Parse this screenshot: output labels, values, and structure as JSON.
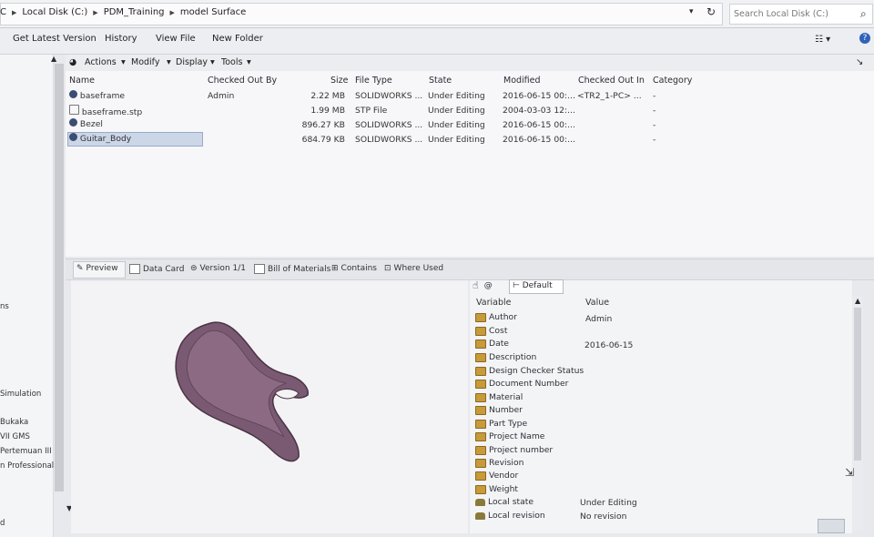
{
  "breadcrumb": {
    "items": [
      "C",
      "Local Disk (C:)",
      "PDM_Training",
      "model Surface"
    ]
  },
  "search": {
    "placeholder": "Search Local Disk (C:)"
  },
  "command_bar": {
    "items": [
      "Get Latest Version",
      "History",
      "View File",
      "New Folder"
    ]
  },
  "toolbar": {
    "items": [
      "Actions",
      "Modify",
      "Display",
      "Tools"
    ]
  },
  "columns": [
    "Name",
    "Checked Out By",
    "Size",
    "File Type",
    "State",
    "Modified",
    "Checked Out In",
    "Category"
  ],
  "files": [
    {
      "name": "baseframe",
      "checked_out_by": "Admin",
      "size": "2.22 MB",
      "type": "SOLIDWORKS ...",
      "state": "Under Editing",
      "modified": "2016-06-15 00:...",
      "checked_out_in": "<TR2_1-PC> ...",
      "category": "-"
    },
    {
      "name": "baseframe.stp",
      "checked_out_by": "",
      "size": "1.99 MB",
      "type": "STP File",
      "state": "Under Editing",
      "modified": "2004-03-03 12:...",
      "checked_out_in": "",
      "category": "-"
    },
    {
      "name": "Bezel",
      "checked_out_by": "",
      "size": "896.27 KB",
      "type": "SOLIDWORKS ...",
      "state": "Under Editing",
      "modified": "2016-06-15 00:...",
      "checked_out_in": "",
      "category": "-"
    },
    {
      "name": "Guitar_Body",
      "checked_out_by": "",
      "size": "684.79 KB",
      "type": "SOLIDWORKS ...",
      "state": "Under Editing",
      "modified": "2016-06-15 00:...",
      "checked_out_in": "",
      "category": "-"
    }
  ],
  "tabs": [
    "Preview",
    "Data Card",
    "Version 1/1",
    "Bill of Materials",
    "Contains",
    "Where Used"
  ],
  "nav": {
    "items": [
      "ns",
      "Simulation",
      "Bukaka",
      "VII GMS",
      "Pertemuan III",
      "n Professional II",
      "d"
    ]
  },
  "card": {
    "config": "Default",
    "header_variable": "Variable",
    "header_value": "Value",
    "variables": [
      {
        "name": "Author",
        "value": "Admin"
      },
      {
        "name": "Cost",
        "value": ""
      },
      {
        "name": "Date",
        "value": "2016-06-15"
      },
      {
        "name": "Description",
        "value": ""
      },
      {
        "name": "Design Checker Status",
        "value": ""
      },
      {
        "name": "Document Number",
        "value": ""
      },
      {
        "name": "Material",
        "value": ""
      },
      {
        "name": "Number",
        "value": ""
      },
      {
        "name": "Part Type",
        "value": ""
      },
      {
        "name": "Project Name",
        "value": ""
      },
      {
        "name": "Project number",
        "value": ""
      },
      {
        "name": "Revision",
        "value": ""
      },
      {
        "name": "Vendor",
        "value": ""
      },
      {
        "name": "Weight",
        "value": ""
      },
      {
        "name": "Local state",
        "value": "Under Editing"
      },
      {
        "name": "Local revision",
        "value": "No revision"
      }
    ]
  },
  "colors": {
    "selection": "#cbd6e7",
    "part_body": "#7a5a72",
    "accent": "#2e63b8"
  }
}
